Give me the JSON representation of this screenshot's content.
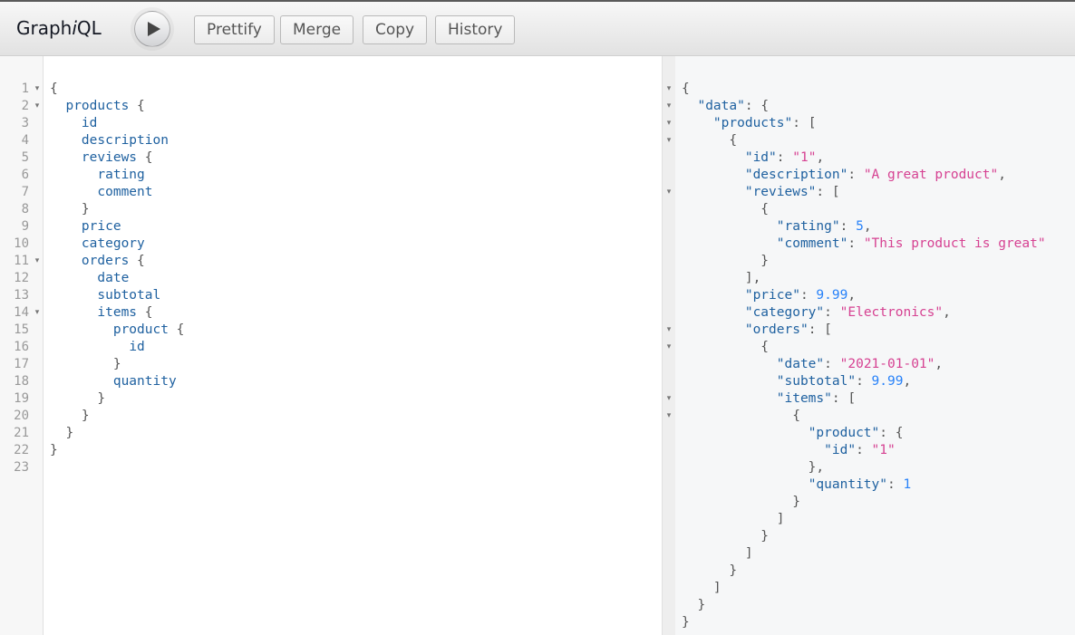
{
  "app": {
    "title_prefix": "Graph",
    "title_italic": "i",
    "title_suffix": "QL"
  },
  "toolbar": {
    "execute_icon": "play-icon",
    "buttons": [
      {
        "label": "Prettify"
      },
      {
        "label": "Merge"
      },
      {
        "label": "Copy"
      },
      {
        "label": "History"
      }
    ]
  },
  "query_editor": {
    "line_numbers": [
      "1",
      "2",
      "3",
      "4",
      "5",
      "6",
      "7",
      "8",
      "9",
      "10",
      "11",
      "12",
      "13",
      "14",
      "15",
      "16",
      "17",
      "18",
      "19",
      "20",
      "21",
      "22",
      "23"
    ],
    "lines": [
      {
        "indent": "",
        "text": "{",
        "kind": "punct",
        "foldable": true
      },
      {
        "indent": "  ",
        "text": "products",
        "suffix": " {",
        "kind": "field",
        "foldable": true
      },
      {
        "indent": "    ",
        "text": "id",
        "kind": "field"
      },
      {
        "indent": "    ",
        "text": "description",
        "kind": "field"
      },
      {
        "indent": "    ",
        "text": "reviews",
        "suffix": " {",
        "kind": "field"
      },
      {
        "indent": "      ",
        "text": "rating",
        "kind": "field"
      },
      {
        "indent": "      ",
        "text": "comment",
        "kind": "field"
      },
      {
        "indent": "    ",
        "text": "}",
        "kind": "punct"
      },
      {
        "indent": "    ",
        "text": "price",
        "kind": "field"
      },
      {
        "indent": "    ",
        "text": "category",
        "kind": "field"
      },
      {
        "indent": "    ",
        "text": "orders",
        "suffix": " {",
        "kind": "field",
        "foldable": true
      },
      {
        "indent": "      ",
        "text": "date",
        "kind": "field"
      },
      {
        "indent": "      ",
        "text": "subtotal",
        "kind": "field"
      },
      {
        "indent": "      ",
        "text": "items",
        "suffix": " {",
        "kind": "field",
        "foldable": true
      },
      {
        "indent": "        ",
        "text": "product",
        "suffix": " {",
        "kind": "field"
      },
      {
        "indent": "          ",
        "text": "id",
        "kind": "field"
      },
      {
        "indent": "        ",
        "text": "}",
        "kind": "punct"
      },
      {
        "indent": "        ",
        "text": "quantity",
        "kind": "field"
      },
      {
        "indent": "      ",
        "text": "}",
        "kind": "punct"
      },
      {
        "indent": "    ",
        "text": "}",
        "kind": "punct"
      },
      {
        "indent": "  ",
        "text": "}",
        "kind": "punct"
      },
      {
        "indent": "",
        "text": "}",
        "kind": "punct"
      },
      {
        "indent": "",
        "text": "",
        "kind": "punct"
      }
    ]
  },
  "result_viewer": {
    "lines": [
      {
        "fold": true,
        "tokens": [
          [
            "p",
            "{"
          ]
        ]
      },
      {
        "fold": true,
        "tokens": [
          [
            "p",
            "  "
          ],
          [
            "k",
            "\"data\""
          ],
          [
            "p",
            ": {"
          ]
        ]
      },
      {
        "fold": true,
        "tokens": [
          [
            "p",
            "    "
          ],
          [
            "k",
            "\"products\""
          ],
          [
            "p",
            ": ["
          ]
        ]
      },
      {
        "fold": true,
        "tokens": [
          [
            "p",
            "      {"
          ]
        ]
      },
      {
        "fold": false,
        "tokens": [
          [
            "p",
            "        "
          ],
          [
            "k",
            "\"id\""
          ],
          [
            "p",
            ": "
          ],
          [
            "s",
            "\"1\""
          ],
          [
            "p",
            ","
          ]
        ]
      },
      {
        "fold": false,
        "tokens": [
          [
            "p",
            "        "
          ],
          [
            "k",
            "\"description\""
          ],
          [
            "p",
            ": "
          ],
          [
            "s",
            "\"A great product\""
          ],
          [
            "p",
            ","
          ]
        ]
      },
      {
        "fold": true,
        "tokens": [
          [
            "p",
            "        "
          ],
          [
            "k",
            "\"reviews\""
          ],
          [
            "p",
            ": ["
          ]
        ]
      },
      {
        "fold": false,
        "tokens": [
          [
            "p",
            "          {"
          ]
        ]
      },
      {
        "fold": false,
        "tokens": [
          [
            "p",
            "            "
          ],
          [
            "k",
            "\"rating\""
          ],
          [
            "p",
            ": "
          ],
          [
            "n",
            "5"
          ],
          [
            "p",
            ","
          ]
        ]
      },
      {
        "fold": false,
        "tokens": [
          [
            "p",
            "            "
          ],
          [
            "k",
            "\"comment\""
          ],
          [
            "p",
            ": "
          ],
          [
            "s",
            "\"This product is great\""
          ]
        ]
      },
      {
        "fold": false,
        "tokens": [
          [
            "p",
            "          }"
          ]
        ]
      },
      {
        "fold": false,
        "tokens": [
          [
            "p",
            "        ],"
          ]
        ]
      },
      {
        "fold": false,
        "tokens": [
          [
            "p",
            "        "
          ],
          [
            "k",
            "\"price\""
          ],
          [
            "p",
            ": "
          ],
          [
            "n",
            "9.99"
          ],
          [
            "p",
            ","
          ]
        ]
      },
      {
        "fold": false,
        "tokens": [
          [
            "p",
            "        "
          ],
          [
            "k",
            "\"category\""
          ],
          [
            "p",
            ": "
          ],
          [
            "s",
            "\"Electronics\""
          ],
          [
            "p",
            ","
          ]
        ]
      },
      {
        "fold": true,
        "tokens": [
          [
            "p",
            "        "
          ],
          [
            "k",
            "\"orders\""
          ],
          [
            "p",
            ": ["
          ]
        ]
      },
      {
        "fold": true,
        "tokens": [
          [
            "p",
            "          {"
          ]
        ]
      },
      {
        "fold": false,
        "tokens": [
          [
            "p",
            "            "
          ],
          [
            "k",
            "\"date\""
          ],
          [
            "p",
            ": "
          ],
          [
            "s",
            "\"2021-01-01\""
          ],
          [
            "p",
            ","
          ]
        ]
      },
      {
        "fold": false,
        "tokens": [
          [
            "p",
            "            "
          ],
          [
            "k",
            "\"subtotal\""
          ],
          [
            "p",
            ": "
          ],
          [
            "n",
            "9.99"
          ],
          [
            "p",
            ","
          ]
        ]
      },
      {
        "fold": true,
        "tokens": [
          [
            "p",
            "            "
          ],
          [
            "k",
            "\"items\""
          ],
          [
            "p",
            ": ["
          ]
        ]
      },
      {
        "fold": true,
        "tokens": [
          [
            "p",
            "              {"
          ]
        ]
      },
      {
        "fold": false,
        "tokens": [
          [
            "p",
            "                "
          ],
          [
            "k",
            "\"product\""
          ],
          [
            "p",
            ": {"
          ]
        ]
      },
      {
        "fold": false,
        "tokens": [
          [
            "p",
            "                  "
          ],
          [
            "k",
            "\"id\""
          ],
          [
            "p",
            ": "
          ],
          [
            "s",
            "\"1\""
          ]
        ]
      },
      {
        "fold": false,
        "tokens": [
          [
            "p",
            "                },"
          ]
        ]
      },
      {
        "fold": false,
        "tokens": [
          [
            "p",
            "                "
          ],
          [
            "k",
            "\"quantity\""
          ],
          [
            "p",
            ": "
          ],
          [
            "n",
            "1"
          ]
        ]
      },
      {
        "fold": false,
        "tokens": [
          [
            "p",
            "              }"
          ]
        ]
      },
      {
        "fold": false,
        "tokens": [
          [
            "p",
            "            ]"
          ]
        ]
      },
      {
        "fold": false,
        "tokens": [
          [
            "p",
            "          }"
          ]
        ]
      },
      {
        "fold": false,
        "tokens": [
          [
            "p",
            "        ]"
          ]
        ]
      },
      {
        "fold": false,
        "tokens": [
          [
            "p",
            "      }"
          ]
        ]
      },
      {
        "fold": false,
        "tokens": [
          [
            "p",
            "    ]"
          ]
        ]
      },
      {
        "fold": false,
        "tokens": [
          [
            "p",
            "  }"
          ]
        ]
      },
      {
        "fold": false,
        "tokens": [
          [
            "p",
            "}"
          ]
        ]
      }
    ]
  },
  "colors": {
    "field": "#1f61a0",
    "string": "#d64292",
    "number": "#2882f9",
    "punctuation": "#555555"
  }
}
